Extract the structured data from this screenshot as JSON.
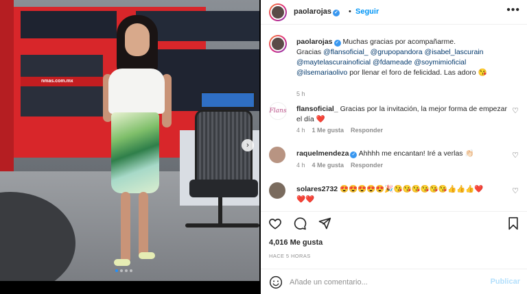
{
  "post": {
    "username": "paolarojas",
    "follow_label": "Seguir",
    "separator": "•",
    "more_icon": "more-horizontal-icon"
  },
  "caption": {
    "username": "paolarojas",
    "text_start": "Muchas gracias por acompañarme.",
    "text_thanks": "Gracias",
    "mentions": [
      "@flansoficial_",
      "@grupopandora",
      "@isabel_lascurain",
      "@maytelascurainoficial",
      "@fdameade",
      "@soymimioficial",
      "@ilsemariaolivo"
    ],
    "text_end": "por llenar el foro de felicidad. Las adoro 😘",
    "time": "5 h"
  },
  "comments": [
    {
      "username": "flansoficial_",
      "text": "Gracias por la invitación, la mejor forma de empezar el día ❤️",
      "time": "4 h",
      "likes": "1 Me gusta",
      "reply": "Responder",
      "avatar_text": "Flans"
    },
    {
      "username": "raquelmendeza",
      "text": "Ahhhh me encantan! Iré a verlas 👏🏻",
      "time": "4 h",
      "likes": "4 Me gusta",
      "reply": "Responder"
    },
    {
      "username": "solares2732",
      "text": "😍😍😍😍😍🎉😘😘😘😘😘😘👍👍👍❤️",
      "text2": "❤️❤️"
    }
  ],
  "actions": {
    "like_icon": "heart-icon",
    "comment_icon": "comment-icon",
    "share_icon": "send-icon",
    "save_icon": "bookmark-icon",
    "likes_count": "4,016 Me gusta",
    "posted_ago": "HACE 5 HORAS"
  },
  "composer": {
    "placeholder": "Añade un comentario...",
    "publish_label": "Publicar",
    "emoji_icon": "smiley-icon"
  },
  "image": {
    "channel_text": "nmas.com.mx",
    "carousel": {
      "count": 4,
      "current": 1
    },
    "next_icon": "chevron-right-icon"
  }
}
